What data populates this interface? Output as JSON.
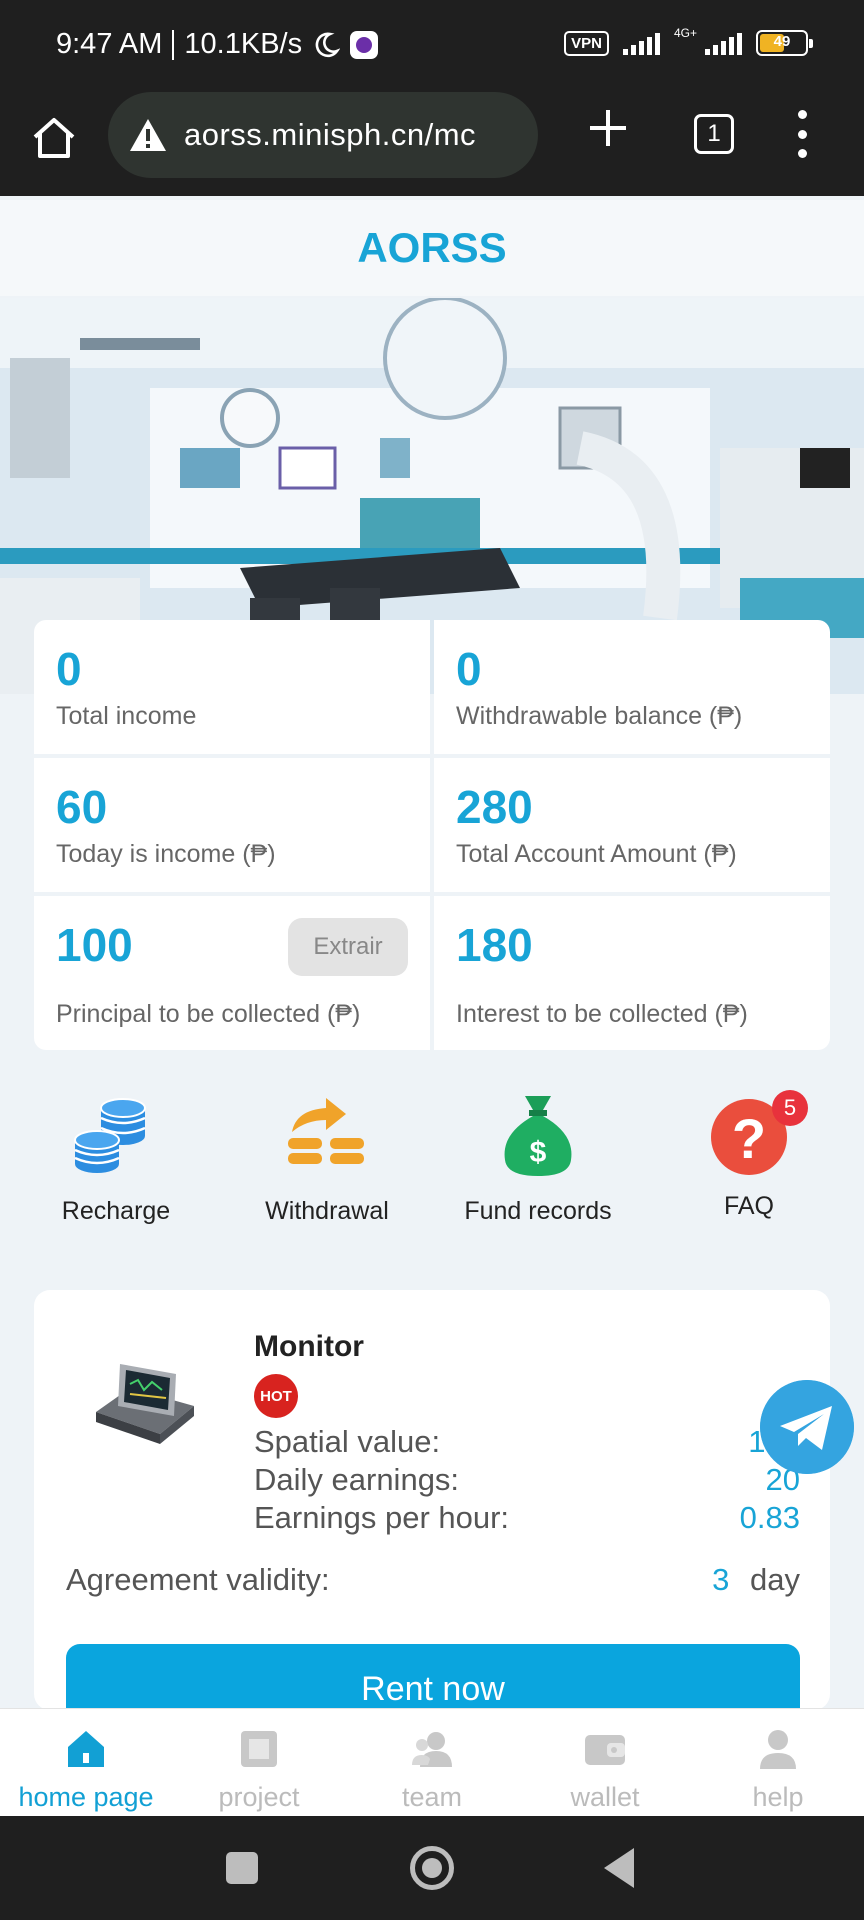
{
  "status_bar": {
    "time": "9:47 AM",
    "speed": "10.1KB/s",
    "vpn": "VPN",
    "network": "4G+",
    "battery": "49"
  },
  "browser": {
    "url": "aorss.minisph.cn/mc",
    "tab_count": "1"
  },
  "page": {
    "title": "AORSS"
  },
  "stats": [
    {
      "value": "0",
      "label": "Total income"
    },
    {
      "value": "0",
      "label": "Withdrawable balance (₱)"
    },
    {
      "value": "60",
      "label": "Today is income (₱)"
    },
    {
      "value": "280",
      "label": "Total Account Amount (₱)"
    },
    {
      "value": "100",
      "label": "Principal to be collected (₱)",
      "button": "Extrair"
    },
    {
      "value": "180",
      "label": "Interest to be collected (₱)"
    }
  ],
  "actions": [
    {
      "label": "Recharge",
      "icon": "coins-stack-icon"
    },
    {
      "label": "Withdrawal",
      "icon": "withdraw-coins-icon"
    },
    {
      "label": "Fund records",
      "icon": "money-bag-icon"
    },
    {
      "label": "FAQ",
      "icon": "question-icon",
      "badge": "5"
    }
  ],
  "product": {
    "name": "Monitor",
    "hot_label": "HOT",
    "rows": [
      {
        "label": "Spatial value:",
        "value": "100"
      },
      {
        "label": "Daily earnings:",
        "value": "20"
      },
      {
        "label": "Earnings per hour:",
        "value": "0.83"
      }
    ],
    "validity_label": "Agreement validity:",
    "validity_value": "3",
    "validity_unit": "day",
    "rent_button": "Rent now"
  },
  "bottom_nav": [
    {
      "label": "home page",
      "active": true
    },
    {
      "label": "project",
      "active": false
    },
    {
      "label": "team",
      "active": false
    },
    {
      "label": "wallet",
      "active": false
    },
    {
      "label": "help",
      "active": false
    }
  ],
  "colors": {
    "accent": "#18a4d6",
    "button": "#0aa5de",
    "hot": "#d8231f",
    "badge": "#e8323c"
  }
}
